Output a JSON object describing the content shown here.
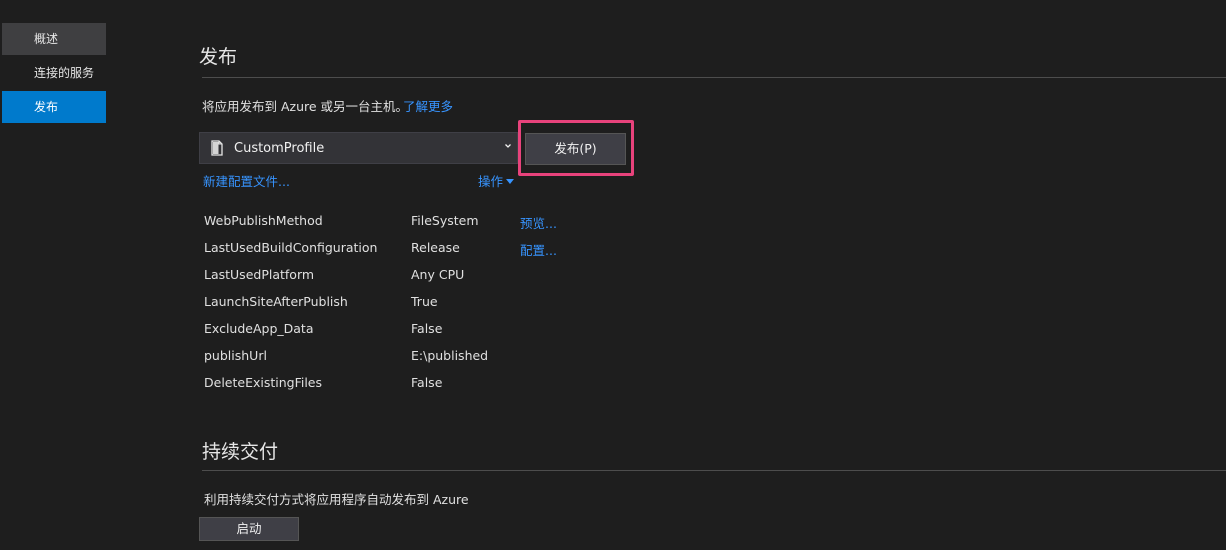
{
  "sidebar": {
    "items": [
      {
        "label": "概述"
      },
      {
        "label": "连接的服务"
      },
      {
        "label": "发布"
      }
    ]
  },
  "publish": {
    "title": "发布",
    "description": "将应用发布到 Azure 或另一台主机。",
    "learn_more": "了解更多",
    "profile": {
      "selected": "CustomProfile",
      "icon": "document-icon"
    },
    "publish_button": "发布(P)",
    "new_profile_link": "新建配置文件...",
    "actions_link": "操作",
    "preview_link": "预览...",
    "configure_link": "配置...",
    "properties": [
      {
        "key": "WebPublishMethod",
        "value": "FileSystem"
      },
      {
        "key": "LastUsedBuildConfiguration",
        "value": "Release"
      },
      {
        "key": "LastUsedPlatform",
        "value": "Any CPU"
      },
      {
        "key": "LaunchSiteAfterPublish",
        "value": "True"
      },
      {
        "key": "ExcludeApp_Data",
        "value": "False"
      },
      {
        "key": "publishUrl",
        "value": "E:\\published"
      },
      {
        "key": "DeleteExistingFiles",
        "value": "False"
      }
    ]
  },
  "continuous_delivery": {
    "title": "持续交付",
    "description": "利用持续交付方式将应用程序自动发布到 Azure",
    "start_button": "启动"
  },
  "colors": {
    "background": "#1e1e1e",
    "accent": "#007acc",
    "link": "#3794ff",
    "highlight": "#e8437c"
  }
}
